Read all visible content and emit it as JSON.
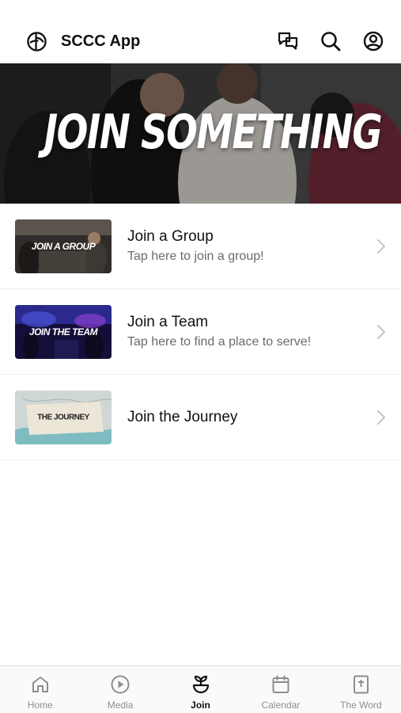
{
  "status_bar": {
    "text": ""
  },
  "header": {
    "title": "SCCC App",
    "actions": [
      "chat-icon",
      "search-icon",
      "account-icon"
    ]
  },
  "hero": {
    "title": "JOIN SOMETHING"
  },
  "items": [
    {
      "title": "Join a Group",
      "subtitle": "Tap here to join a group!",
      "thumb_text": "JOIN A GROUP",
      "icon": "chevron-right-icon"
    },
    {
      "title": "Join a Team",
      "subtitle": "Tap here to find a place to serve!",
      "thumb_text": "JOIN THE TEAM",
      "icon": "chevron-right-icon"
    },
    {
      "title": "Join the Journey",
      "subtitle": "",
      "thumb_text": "THE JOURNEY",
      "icon": "chevron-right-icon"
    }
  ],
  "tabs": [
    {
      "label": "Home",
      "icon": "home-icon",
      "active": false
    },
    {
      "label": "Media",
      "icon": "play-icon",
      "active": false
    },
    {
      "label": "Join",
      "icon": "sprout-icon",
      "active": true
    },
    {
      "label": "Calendar",
      "icon": "calendar-icon",
      "active": false
    },
    {
      "label": "The Word",
      "icon": "bible-icon",
      "active": false
    }
  ],
  "colors": {
    "active_tab": "#111111",
    "inactive_tab": "#8e8e8e",
    "subtitle": "#6b6b6b"
  }
}
